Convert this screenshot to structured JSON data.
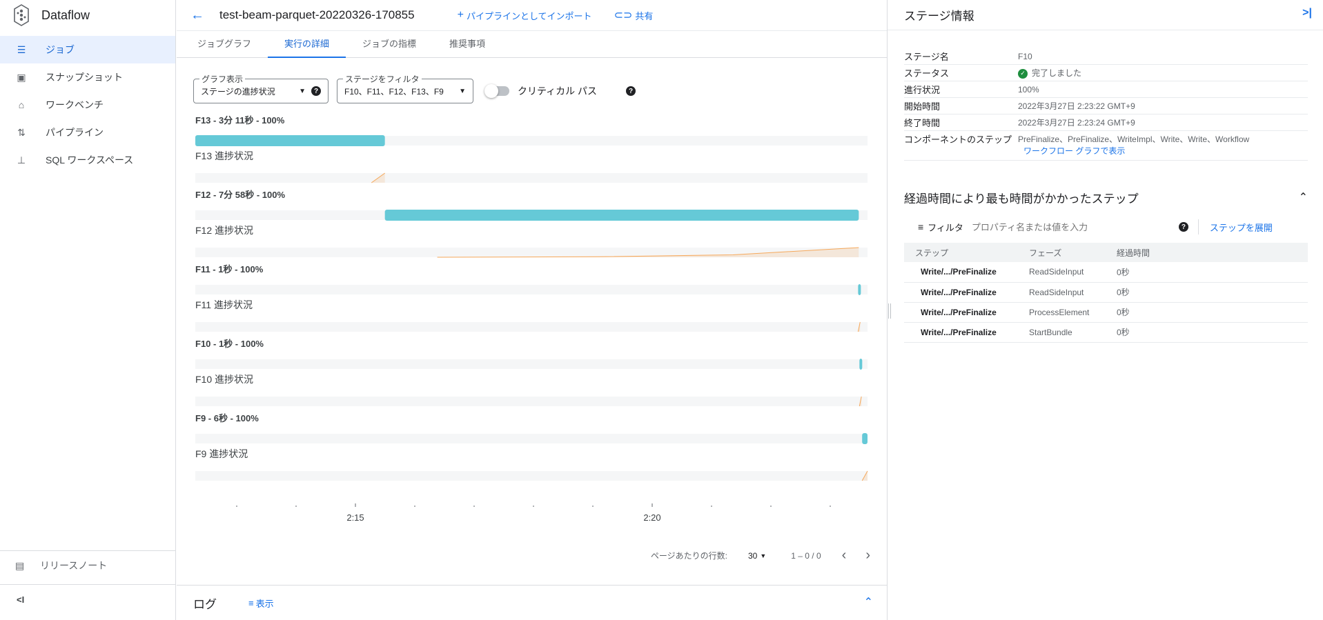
{
  "app": {
    "name": "Dataflow"
  },
  "sidebar": {
    "items": [
      {
        "label": "ジョブ",
        "icon": "list-icon",
        "active": true
      },
      {
        "label": "スナップショット",
        "icon": "snapshot-icon",
        "active": false
      },
      {
        "label": "ワークベンチ",
        "icon": "workbench-icon",
        "active": false
      },
      {
        "label": "パイプライン",
        "icon": "pipeline-icon",
        "active": false
      },
      {
        "label": "SQL ワークスペース",
        "icon": "sitemap-icon",
        "active": false
      }
    ],
    "release_notes": "リリースノート"
  },
  "topbar": {
    "job_name": "test-beam-parquet-20220326-170855",
    "import_label": "パイプラインとしてインポート",
    "share_label": "共有"
  },
  "tabs": [
    {
      "label": "ジョブグラフ",
      "active": false
    },
    {
      "label": "実行の詳細",
      "active": true
    },
    {
      "label": "ジョブの指標",
      "active": false
    },
    {
      "label": "推奨事項",
      "active": false
    }
  ],
  "controls": {
    "graph_view": {
      "legend": "グラフ表示",
      "value": "ステージの進捗状況"
    },
    "stage_filter": {
      "legend": "ステージをフィルタ",
      "value": "F10、F11、F12、F13、F9"
    },
    "critical_path_label": "クリティカル パス"
  },
  "chart_data": {
    "type": "gantt",
    "x_ticks": [
      "2:15",
      "2:20"
    ],
    "colors": {
      "bar": "#65c9d7",
      "progress": "#f6a85a",
      "track": "#f5f6f7"
    },
    "stages": [
      {
        "label": "F13 - 3分 11秒 - 100%",
        "progress_label": "F13 進捗状況",
        "start": 0.0,
        "end": 0.282,
        "progress": [
          [
            0.262,
            0.0
          ],
          [
            0.282,
            1.0
          ]
        ]
      },
      {
        "label": "F12 - 7分 58秒 - 100%",
        "progress_label": "F12 進捗状況",
        "start": 0.282,
        "end": 0.987,
        "progress": [
          [
            0.36,
            0.0
          ],
          [
            0.6,
            0.05
          ],
          [
            0.8,
            0.25
          ],
          [
            0.987,
            1.0
          ]
        ]
      },
      {
        "label": "F11 - 1秒 - 100%",
        "progress_label": "F11 進捗状況",
        "start": 0.986,
        "end": 0.99,
        "progress": [
          [
            0.986,
            0.0
          ],
          [
            0.989,
            1.0
          ]
        ]
      },
      {
        "label": "F10 - 1秒 - 100%",
        "progress_label": "F10 進捗状況",
        "start": 0.988,
        "end": 0.992,
        "progress": [
          [
            0.988,
            0.0
          ],
          [
            0.991,
            1.0
          ]
        ]
      },
      {
        "label": "F9 - 6秒 - 100%",
        "progress_label": "F9 進捗状況",
        "start": 0.992,
        "end": 1.0,
        "progress": [
          [
            0.992,
            0.0
          ],
          [
            1.0,
            1.0
          ]
        ]
      }
    ]
  },
  "pager": {
    "rows_label": "ページあたりの行数:",
    "rows_value": "30",
    "range": "1 – 0 / 0"
  },
  "log": {
    "title": "ログ",
    "show_label": "表示"
  },
  "panel": {
    "title": "ステージ情報",
    "info": {
      "stage_name_key": "ステージ名",
      "stage_name": "F10",
      "status_key": "ステータス",
      "status": "完了しました",
      "progress_key": "進行状況",
      "progress": "100%",
      "start_key": "開始時間",
      "start": "2022年3月27日 2:23:22 GMT+9",
      "end_key": "終了時間",
      "end": "2022年3月27日 2:23:24 GMT+9",
      "steps_key": "コンポーネントのステップ",
      "steps": "PreFinalize、PreFinalize、WriteImpl、Write、Write、Workflow",
      "workflow_link": "ワークフロー グラフで表示"
    },
    "section_title": "経過時間により最も時間がかかったステップ",
    "filter": {
      "label": "フィルタ",
      "placeholder": "プロパティ名または値を入力",
      "expand_label": "ステップを展開"
    },
    "table": {
      "headers": [
        "ステップ",
        "フェーズ",
        "経過時間"
      ],
      "rows": [
        [
          "Write/.../PreFinalize",
          "ReadSideInput",
          "0秒"
        ],
        [
          "Write/.../PreFinalize",
          "ReadSideInput",
          "0秒"
        ],
        [
          "Write/.../PreFinalize",
          "ProcessElement",
          "0秒"
        ],
        [
          "Write/.../PreFinalize",
          "StartBundle",
          "0秒"
        ]
      ]
    }
  }
}
